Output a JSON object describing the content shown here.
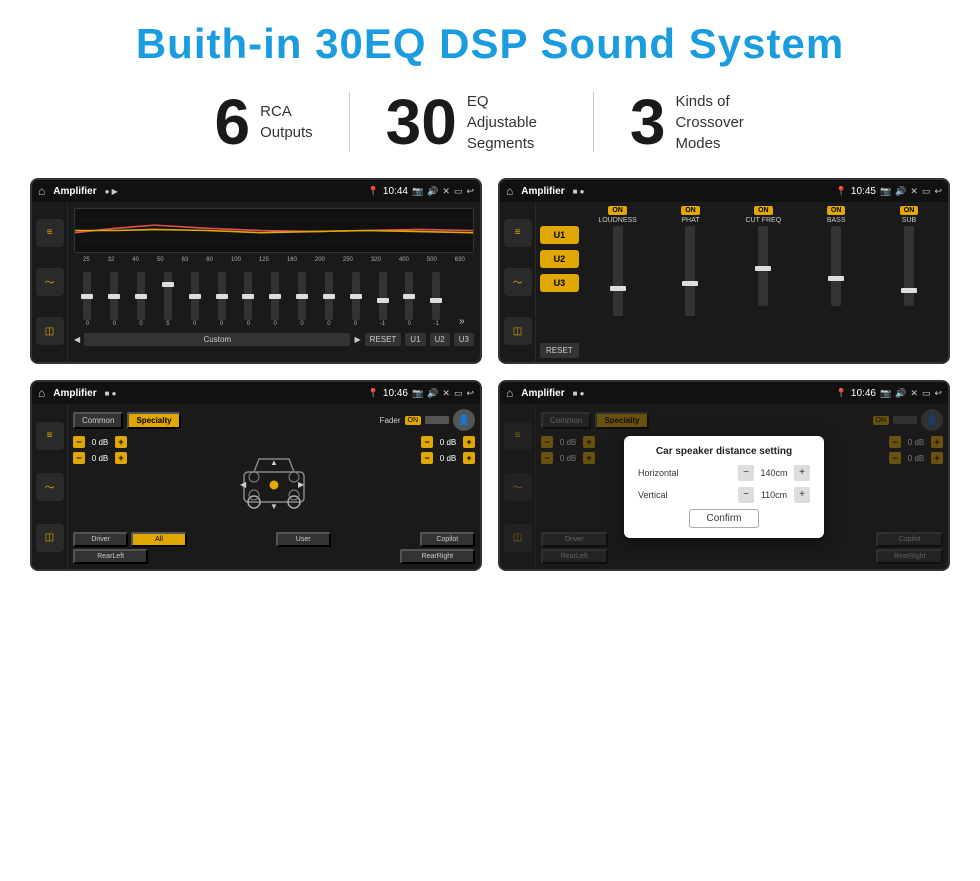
{
  "header": {
    "title": "Buith-in 30EQ DSP Sound System"
  },
  "stats": [
    {
      "number": "6",
      "label": "RCA\nOutputs"
    },
    {
      "number": "30",
      "label": "EQ Adjustable\nSegments"
    },
    {
      "number": "3",
      "label": "Kinds of\nCrossover Modes"
    }
  ],
  "screens": {
    "eq": {
      "app_name": "Amplifier",
      "time": "10:44",
      "freq_labels": [
        "25",
        "32",
        "40",
        "50",
        "63",
        "80",
        "100",
        "125",
        "160",
        "200",
        "250",
        "320",
        "400",
        "500",
        "630"
      ],
      "values": [
        "0",
        "0",
        "0",
        "5",
        "0",
        "0",
        "0",
        "0",
        "0",
        "0",
        "0",
        "-1",
        "0",
        "-1"
      ],
      "buttons": [
        "Custom",
        "RESET",
        "U1",
        "U2",
        "U3"
      ]
    },
    "crossover": {
      "app_name": "Amplifier",
      "time": "10:45",
      "u_buttons": [
        "U1",
        "U2",
        "U3"
      ],
      "controls": [
        {
          "toggle": "ON",
          "label": "LOUDNESS"
        },
        {
          "toggle": "ON",
          "label": "PHAT"
        },
        {
          "toggle": "ON",
          "label": "CUT FREQ"
        },
        {
          "toggle": "ON",
          "label": "BASS"
        },
        {
          "toggle": "ON",
          "label": "SUB"
        }
      ],
      "reset_label": "RESET"
    },
    "speaker_fader": {
      "app_name": "Amplifier",
      "time": "10:46",
      "tabs": [
        "Common",
        "Specialty"
      ],
      "active_tab": "Specialty",
      "fader_label": "Fader",
      "fader_on": "ON",
      "db_values": [
        "0 dB",
        "0 dB",
        "0 dB",
        "0 dB"
      ],
      "nav_buttons": [
        "Driver",
        "All",
        "User",
        "RearLeft",
        "Copilot",
        "RearRight"
      ]
    },
    "speaker_dialog": {
      "app_name": "Amplifier",
      "time": "10:46",
      "tabs": [
        "Common",
        "Specialty"
      ],
      "dialog": {
        "title": "Car speaker distance setting",
        "horizontal_label": "Horizontal",
        "horizontal_value": "140cm",
        "vertical_label": "Vertical",
        "vertical_value": "110cm",
        "confirm_label": "Confirm"
      },
      "db_values": [
        "0 dB",
        "0 dB"
      ],
      "nav_buttons": [
        "Driver",
        "RearLeft",
        "Copilot",
        "RearRight"
      ]
    }
  }
}
